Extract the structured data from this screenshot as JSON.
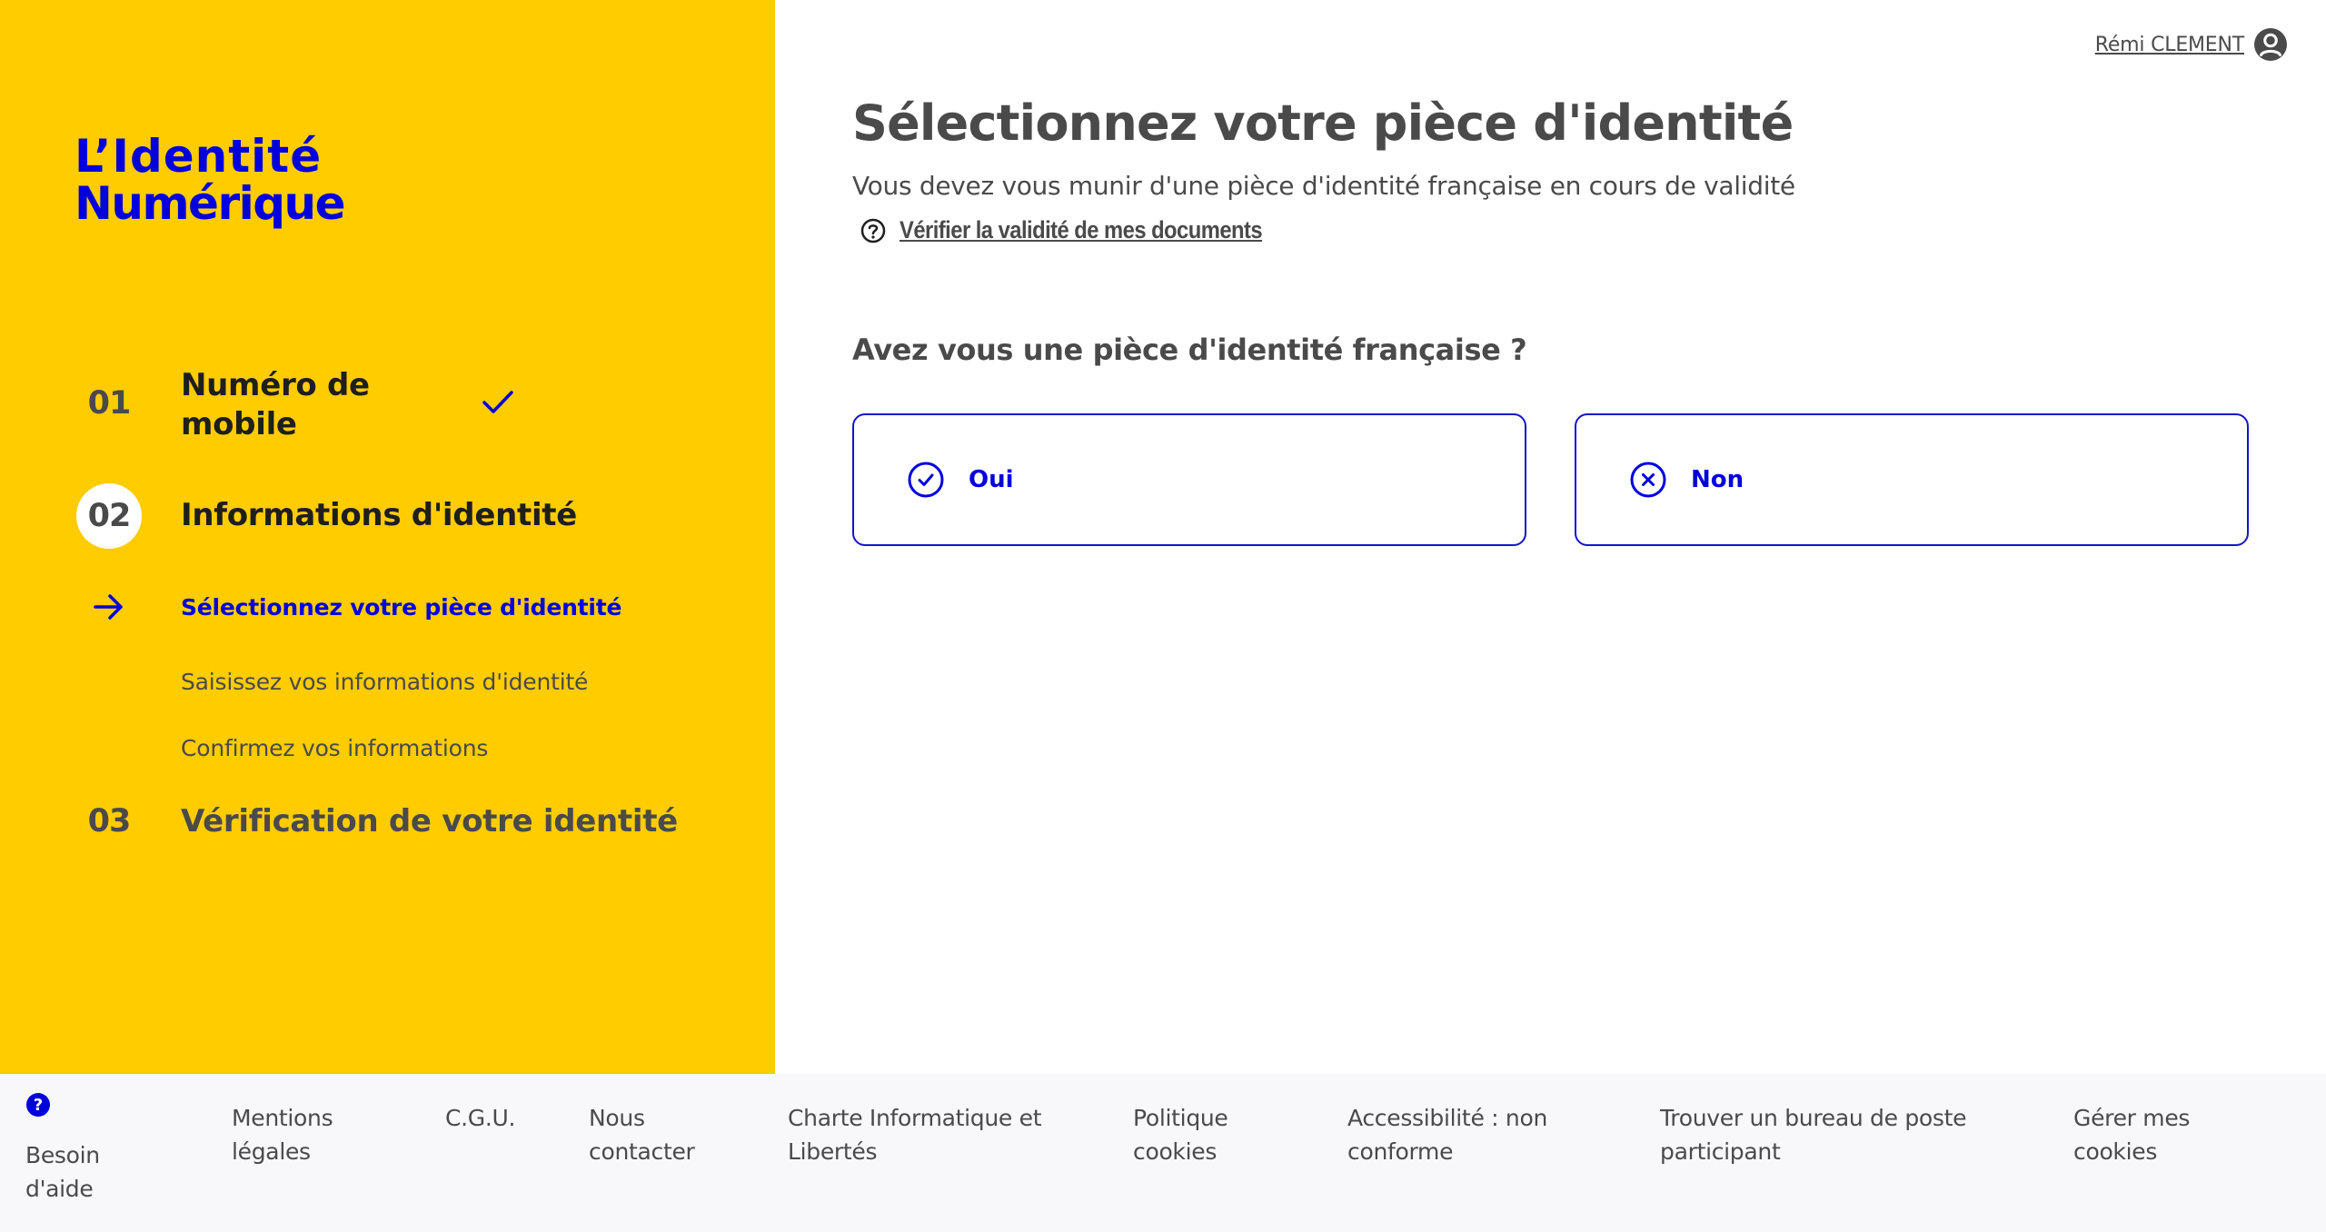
{
  "brand": {
    "line1": "L’Identité",
    "line2": "Numérique",
    "accent_color": "#0000dd",
    "panel_color": "#ffcc00"
  },
  "user": {
    "name": "Rémi CLEMENT",
    "icon": "account-circle-icon"
  },
  "steps": [
    {
      "number": "01",
      "title_line1": "Numéro de",
      "title_line2": "mobile",
      "status": "completed",
      "status_icon": "checkmark-icon"
    },
    {
      "number": "02",
      "title": "Informations d'identité",
      "status": "current",
      "substeps": [
        {
          "label": "Sélectionnez votre pièce d'identité",
          "status": "active",
          "icon": "arrow-right-icon"
        },
        {
          "label": "Saisissez vos informations d'identité",
          "status": "pending"
        },
        {
          "label": "Confirmez vos informations",
          "status": "pending"
        }
      ]
    },
    {
      "number": "03",
      "title": "Vérification de votre identité",
      "status": "pending"
    }
  ],
  "main": {
    "title": "Sélectionnez votre pièce d'identité",
    "subtitle": "Vous devez vous munir d'une pièce d'identité française en cours de validité",
    "help_link": "Vérifier la validité de mes documents",
    "question": "Avez vous une pièce d'identité française ?",
    "options": [
      {
        "label": "Oui",
        "icon": "check-circle-icon"
      },
      {
        "label": "Non",
        "icon": "x-circle-icon"
      }
    ]
  },
  "footer": {
    "help": {
      "line1": "Besoin",
      "line2": "d'aide",
      "icon": "question-badge-icon"
    },
    "links": [
      {
        "line1": "Mentions",
        "line2": "légales"
      },
      {
        "line1": "C.G.U.",
        "line2": ""
      },
      {
        "line1": "Nous",
        "line2": "contacter"
      },
      {
        "line1": "Charte Informatique et",
        "line2": "Libertés"
      },
      {
        "line1": "Politique",
        "line2": "cookies"
      },
      {
        "line1": "Accessibilité : non",
        "line2": "conforme"
      },
      {
        "line1": "Trouver un bureau de poste",
        "line2": "participant"
      },
      {
        "line1": "Gérer mes",
        "line2": "cookies"
      }
    ]
  }
}
